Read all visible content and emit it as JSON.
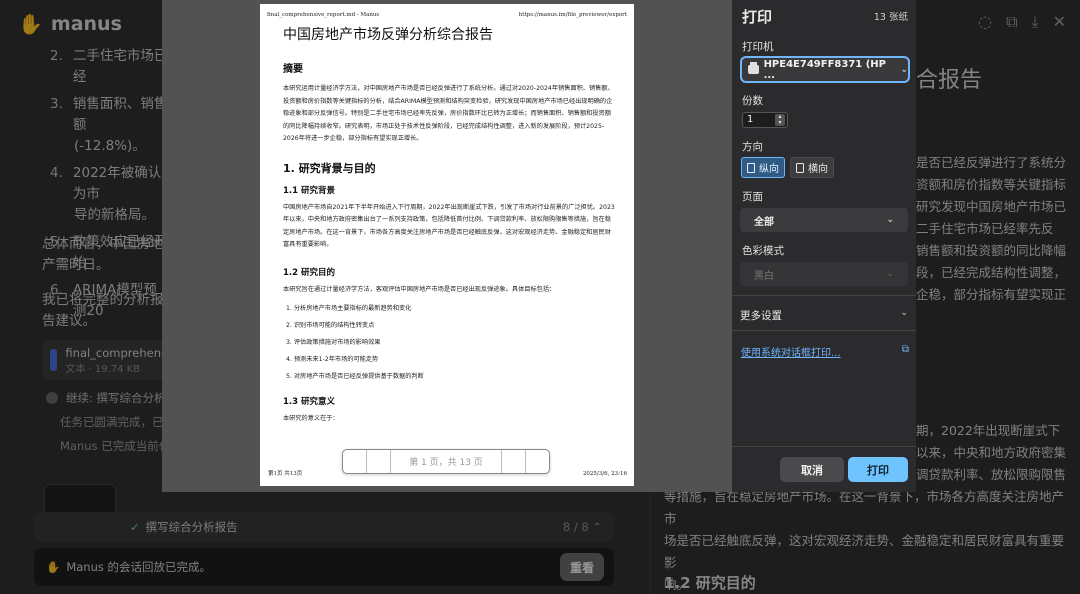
{
  "app": {
    "name": "manus",
    "list": [
      {
        "num": "2.",
        "text": "二手住宅市场已经"
      },
      {
        "num": "3.",
        "text": "销售面积、销售额"
      },
      {
        "num": "",
        "text": "(-12.8%)。"
      },
      {
        "num": "4.",
        "text": "2022年被确认为市"
      },
      {
        "num": "",
        "text": "导的新格局。"
      },
      {
        "num": "5.",
        "text": "政策效应已经开始"
      },
      {
        "num": "6.",
        "text": "ARIMA模型预测20"
      }
    ],
    "para1": "总体而言，中国房地产需时日。",
    "para2": "我已将完整的分析报告建议。",
    "file": {
      "name": "final_comprehens",
      "meta": "文本 · 19.74 KB"
    },
    "step_label": "继续: 撰写综合分析报",
    "sub1": "任务已圆满完成，已向",
    "sub2": "Manus 已完成当前任务",
    "task_bar": {
      "label": "撰写综合分析报告",
      "progress": "8 / 8"
    },
    "replay": {
      "text": "Manus 的会话回放已完成。",
      "button": "重看"
    },
    "right": {
      "title": "合报告",
      "para_lines": [
        "是否已经反弹进行了系统分",
        "资额和房价指数等关键指标",
        "研究发现中国房地产市场已",
        "二手住宅市场已经率先反",
        "销售额和投资额的同比降幅",
        "段，已经完成结构性调整，",
        "企稳，部分指标有望实现正"
      ],
      "para2_lines": [
        "期，2022年出现断崖式下",
        "以来，中央和地方政府密集",
        "调贷款利率、放松限购限售",
        "等措施，旨在稳定房地产市场。在这一背景下，市场各方高度关注房地产市",
        "场是否已经触底反弹，这对宏观经济走势、金融稳定和居民财富具有重要影",
        "响。"
      ],
      "h3": "1.2 研究目的"
    }
  },
  "preview": {
    "header_left": "final_comprehensive_report.md - Manus",
    "header_right": "https://manus.im/file_previewer/export",
    "title": "中国房地产市场反弹分析综合报告",
    "abstract_h": "摘要",
    "abstract": "本研究运用计量经济学方法，对中国房地产市场是否已经反弹进行了系统分析。通过对2020-2024年销售面积、销售额、投资额和房价指数等关键指标的分析，结合ARIMA模型预测和结构突变检验，研究发现中国房地产市场已经出现明确的企稳迹象和部分反弹信号。特别是二手住宅市场已经率先反弹，房价指数环比已转为正增长；而销售面积、销售额和投资额的同比降幅持续收窄。研究表明，市场正处于技术性反弹阶段，已经完成结构性调整，进入新的发展阶段，预计2025-2026年将进一步企稳，部分指标有望实现正增长。",
    "s1": "1. 研究背景与目的",
    "s11": "1.1 研究背景",
    "s11_p": "中国房地产市场自2021年下半年开始进入下行周期，2022年出现断崖式下跌，引发了市场对行业前景的广泛担忧。2023年以来，中央和地方政府密集出台了一系列支持政策，包括降低首付比例、下调贷款利率、放松限购限售等措施，旨在稳定房地产市场。在这一背景下，市场各方高度关注房地产市场是否已经触底反弹，这对宏观经济走势、金融稳定和居民财富具有重要影响。",
    "s12": "1.2 研究目的",
    "s12_p": "本研究旨在通过计量经济学方法，客观评估中国房地产市场是否已经出现反弹迹象。具体目标包括：",
    "goals": [
      "1.  分析房地产市场主要指标的最新趋势和变化",
      "2.  识别市场可能的结构性转变点",
      "3.  评估政策措施对市场的影响效果",
      "4.  预测未来1-2年市场的可能走势",
      "5.  对房地产市场是否已经反弹提供基于数据的判断"
    ],
    "s13": "1.3 研究意义",
    "s13_p": "本研究的意义在于：",
    "footer_left": "第1页 共13页",
    "footer_right": "2025/3/6, 23:16",
    "pager": "第 1 页，共 13 页"
  },
  "print_panel": {
    "title": "打印",
    "sheets": "13 张纸",
    "printer_label": "打印机",
    "printer_value": "HPE4E749FF8371 (HP ...",
    "copies_label": "份数",
    "copies_value": "1",
    "orientation_label": "方向",
    "portrait": "纵向",
    "landscape": "横向",
    "pages_label": "页面",
    "pages_value": "全部",
    "color_label": "色彩模式",
    "color_value": "黑白",
    "more_settings": "更多设置",
    "system_dialog": "使用系统对话框打印...",
    "cancel": "取消",
    "print": "打印"
  }
}
